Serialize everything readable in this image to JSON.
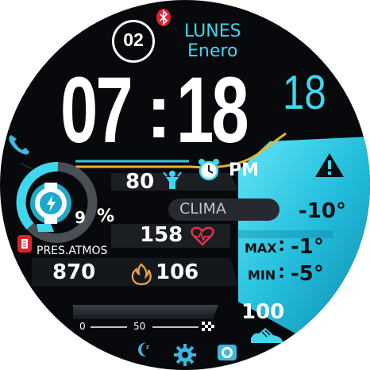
{
  "date": {
    "day_number": "02",
    "weekday": "LUNES",
    "month": "Enero"
  },
  "time": {
    "hours": "07",
    "separator": ":",
    "minutes": "18",
    "seconds": "18",
    "ampm": "PM"
  },
  "battery": {
    "percent_value": "9",
    "percent_sign": "%",
    "level_fraction": 0.09
  },
  "heart_rate_top": {
    "value": "80"
  },
  "heart_rate": {
    "value": "158"
  },
  "weather": {
    "label": "CLIMA",
    "current_temp": "-10°",
    "max_label": "MAX",
    "max_temp": "-1°",
    "min_label": "MIN",
    "min_temp": "-5°"
  },
  "pressure": {
    "label": "PRES.ATMOS",
    "value": "870"
  },
  "calories": {
    "value": "106"
  },
  "steps": {
    "value": "100"
  },
  "progress": {
    "scale_start": "0",
    "scale_mid": "50",
    "level_fraction": 0.0
  },
  "colors": {
    "accent_cyan": "#3fd6ee",
    "panel_cyan": "#1fb9d8",
    "bluetooth_red": "#e2212e",
    "gold": "#e8b23a",
    "heart_red": "#e5324c"
  },
  "icons": [
    "bluetooth-icon",
    "phone-icon",
    "watch-icon",
    "person-icon",
    "alarm-icon",
    "warning-icon",
    "heart-icon",
    "barometer-icon",
    "flame-icon",
    "checkered-flag-icon",
    "shoe-icon",
    "moon-icon",
    "gear-icon",
    "camera-icon"
  ]
}
